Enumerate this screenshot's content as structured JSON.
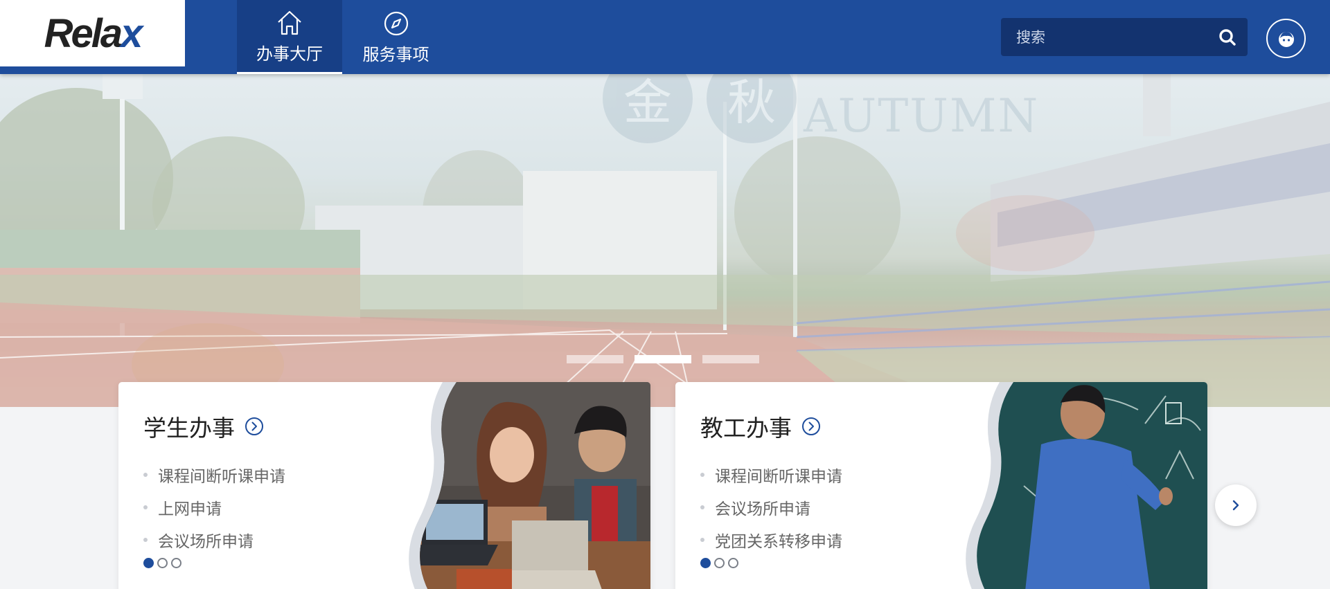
{
  "logo": {
    "text_main": "Rela",
    "text_x": "x"
  },
  "nav": [
    {
      "label": "办事大厅",
      "icon": "home-icon",
      "active": true
    },
    {
      "label": "服务事项",
      "icon": "compass-icon",
      "active": false
    }
  ],
  "search": {
    "placeholder": "搜索",
    "value": ""
  },
  "banner": {
    "watermark_chars": [
      "金",
      "秋"
    ],
    "watermark_text": "AUTUMN",
    "slides": 3,
    "active_slide": 2
  },
  "cards": [
    {
      "title": "学生办事",
      "items": [
        "课程间断听课申请",
        "上网申请",
        "会议场所申请"
      ],
      "pages": 3,
      "active_page": 1,
      "image": "students-with-laptops"
    },
    {
      "title": "教工办事",
      "items": [
        "课程间断听课申请",
        "会议场所申请",
        "党团关系转移申请"
      ],
      "pages": 3,
      "active_page": 1,
      "image": "teacher-at-chalkboard"
    }
  ],
  "colors": {
    "brand": "#1e4d9c",
    "brand_dark": "#173f86",
    "search_bg": "#13336f"
  }
}
